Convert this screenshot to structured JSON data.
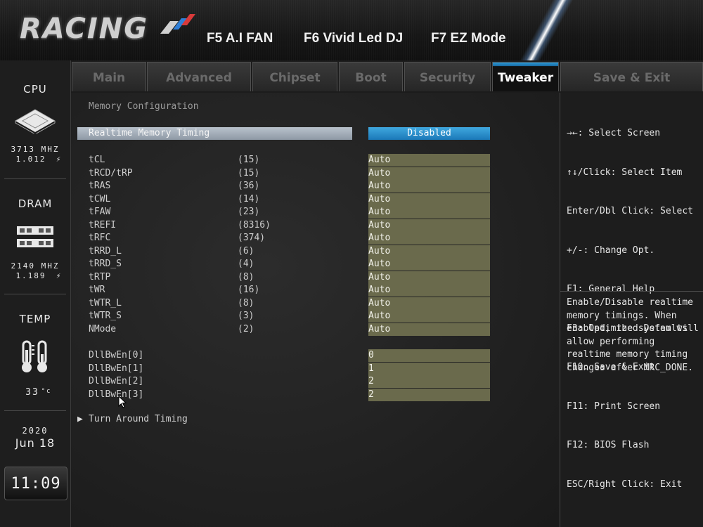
{
  "header": {
    "logo_text": "RACING",
    "fkeys": [
      "F5 A.I FAN",
      "F6 Vivid Led DJ",
      "F7 EZ Mode"
    ]
  },
  "sidebar": {
    "cpu": {
      "title": "CPU",
      "freq": "3713 MHZ",
      "volt": "1.012"
    },
    "dram": {
      "title": "DRAM",
      "freq": "2140 MHZ",
      "volt": "1.189"
    },
    "temp": {
      "title": "TEMP",
      "value": "33"
    },
    "date": {
      "year": "2020",
      "day": "Jun 18"
    },
    "time": "11:09"
  },
  "tabs": [
    "Main",
    "Advanced",
    "Chipset",
    "Boot",
    "Security",
    "Tweaker",
    "Save & Exit"
  ],
  "active_tab": "Tweaker",
  "main": {
    "section_title": "Memory Configuration",
    "realtime": {
      "label": "Realtime Memory Timing",
      "value": "Disabled"
    },
    "timings": [
      {
        "label": "tCL",
        "current": "(15)",
        "value": "Auto"
      },
      {
        "label": "tRCD/tRP",
        "current": "(15)",
        "value": "Auto"
      },
      {
        "label": "tRAS",
        "current": "(36)",
        "value": "Auto"
      },
      {
        "label": "tCWL",
        "current": "(14)",
        "value": "Auto"
      },
      {
        "label": "tFAW",
        "current": "(23)",
        "value": "Auto"
      },
      {
        "label": "tREFI",
        "current": "(8316)",
        "value": "Auto"
      },
      {
        "label": "tRFC",
        "current": "(374)",
        "value": "Auto"
      },
      {
        "label": "tRRD_L",
        "current": "(6)",
        "value": "Auto"
      },
      {
        "label": "tRRD_S",
        "current": "(4)",
        "value": "Auto"
      },
      {
        "label": "tRTP",
        "current": "(8)",
        "value": "Auto"
      },
      {
        "label": "tWR",
        "current": "(16)",
        "value": "Auto"
      },
      {
        "label": "tWTR_L",
        "current": "(8)",
        "value": "Auto"
      },
      {
        "label": "tWTR_S",
        "current": "(3)",
        "value": "Auto"
      },
      {
        "label": "NMode",
        "current": "(2)",
        "value": "Auto"
      }
    ],
    "dll": [
      {
        "label": "DllBwEn[0]",
        "value": "0"
      },
      {
        "label": "DllBwEn[1]",
        "value": "1"
      },
      {
        "label": "DllBwEn[2]",
        "value": "2"
      },
      {
        "label": "DllBwEn[3]",
        "value": "2"
      }
    ],
    "submenu": "Turn Around Timing"
  },
  "help": {
    "keys": [
      "→←: Select Screen",
      "↑↓/Click: Select Item",
      "Enter/Dbl Click: Select",
      "+/-: Change Opt.",
      "F1: General Help",
      "F3: Optimized Defaults",
      "F10: Save & Exit",
      "F11: Print Screen",
      "F12: BIOS Flash",
      "ESC/Right Click: Exit"
    ],
    "description": "Enable/Disable realtime memory timings. When enabled, the system will allow performing realtime memory timing changes after MRC_DONE."
  },
  "colors": {
    "accent_blue": "#2a9ad8",
    "value_box": "#6a6a4c",
    "highlight_bar": "#a3adb8"
  }
}
